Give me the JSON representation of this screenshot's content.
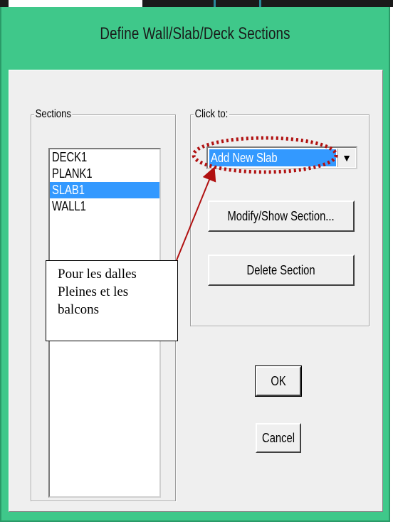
{
  "window": {
    "title": "Define Wall/Slab/Deck Sections"
  },
  "sections_group": {
    "label": "Sections",
    "items": [
      {
        "label": "DECK1",
        "selected": false
      },
      {
        "label": "PLANK1",
        "selected": false
      },
      {
        "label": "SLAB1",
        "selected": true
      },
      {
        "label": "WALL1",
        "selected": false
      }
    ]
  },
  "click_group": {
    "label": "Click to:",
    "combo_value": "Add New Slab",
    "modify_label": "Modify/Show Section...",
    "delete_label": "Delete Section"
  },
  "buttons": {
    "ok": "OK",
    "cancel": "Cancel"
  },
  "annotation": {
    "line1": "Pour les dalles",
    "line2": "Pleines et les",
    "line3": "balcons",
    "color": "#b01010"
  },
  "colors": {
    "frame": "#3fc88a",
    "selection": "#3399ff",
    "dialog_bg": "#efefef"
  }
}
